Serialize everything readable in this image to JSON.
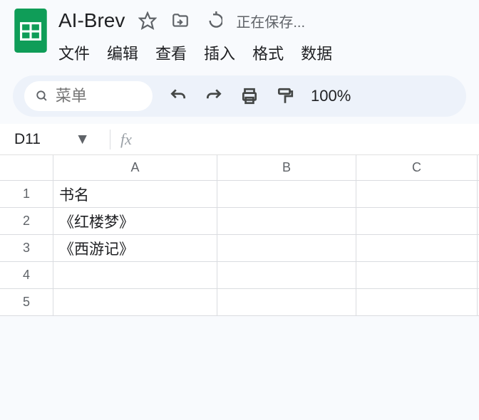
{
  "header": {
    "title": "AI-Brev",
    "save_status": "正在保存...",
    "menu": [
      "文件",
      "编辑",
      "查看",
      "插入",
      "格式",
      "数据"
    ]
  },
  "toolbar": {
    "search_placeholder": "菜单",
    "zoom": "100%"
  },
  "fxbar": {
    "cell_ref": "D11",
    "fx_label": "fx"
  },
  "grid": {
    "columns": [
      "A",
      "B",
      "C"
    ],
    "rows": [
      {
        "n": "1",
        "a": "书名",
        "b": "",
        "c": ""
      },
      {
        "n": "2",
        "a": "《红楼梦》",
        "b": "",
        "c": ""
      },
      {
        "n": "3",
        "a": "《西游记》",
        "b": "",
        "c": ""
      },
      {
        "n": "4",
        "a": "",
        "b": "",
        "c": ""
      },
      {
        "n": "5",
        "a": "",
        "b": "",
        "c": ""
      }
    ]
  }
}
